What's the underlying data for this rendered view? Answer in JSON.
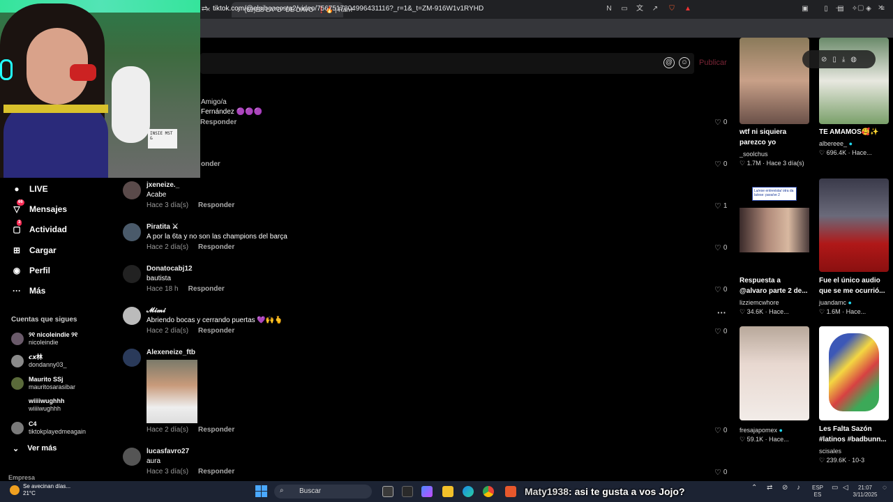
{
  "browser": {
    "tab_active": "(69)ES LA \"D\" DE DAVO",
    "tab_active_extra": "❗🔥 | Ran",
    "new_tab": "+",
    "close": "×",
    "url_site": "tiktok.com",
    "url_path": "/@elpibeacosta2/video/7567517804996431116?_r=1&_t=ZM-916W1v1RYHD",
    "win_min": "—",
    "win_max": "▢",
    "win_close": "✕"
  },
  "composer": {
    "at": "@",
    "emoji": "☺",
    "publish": "Publicar"
  },
  "webcam": {
    "sign_text": "INSIE\nMST\n&"
  },
  "sidebar": {
    "items": [
      {
        "label": "LIVE",
        "icon": "live-icon",
        "glyph": "●"
      },
      {
        "label": "Mensajes",
        "icon": "messages-icon",
        "glyph": "▽",
        "badge": "66"
      },
      {
        "label": "Actividad",
        "icon": "activity-icon",
        "glyph": "▢",
        "badge": "3"
      },
      {
        "label": "Cargar",
        "icon": "upload-icon",
        "glyph": "⊞"
      },
      {
        "label": "Perfil",
        "icon": "profile-icon",
        "glyph": "◉"
      },
      {
        "label": "Más",
        "icon": "more-icon",
        "glyph": "···"
      }
    ],
    "following_title": "Cuentas que sigues",
    "following": [
      {
        "name": "୨୧ nicoleindie ୨୧",
        "handle": "nicoleindie"
      },
      {
        "name": "𝙘𝙭林",
        "handle": "dondanny03_"
      },
      {
        "name": "Maurito SSj",
        "handle": "mauritosarasibar"
      },
      {
        "name": "wiiiiwughhh",
        "handle": "wiiiiwughhh"
      },
      {
        "name": "C4",
        "handle": "tiktokplayedmeagain"
      }
    ],
    "see_more": "Ver más",
    "see_more_icon": "⌄",
    "company": "Empresa"
  },
  "partial_comments": {
    "c1_user": "Amigo/a",
    "c1_text": "Fernández 🟣🟣🟣",
    "c1_reply": "Responder",
    "c2_reply": "onder"
  },
  "comments": [
    {
      "user": "jxeneize._",
      "text": "Acabe",
      "time": "Hace 3 día(s)",
      "reply": "Responder",
      "likes": "1"
    },
    {
      "user": "Piratita ⚔",
      "text": "A por la 6ta y no son las champions del barça",
      "time": "Hace 2 día(s)",
      "reply": "Responder",
      "likes": "0"
    },
    {
      "user": "Donatocabj12",
      "text": "bautista",
      "time": "Hace 18 h",
      "reply": "Responder",
      "likes": "0"
    },
    {
      "user": "𝓜𝓲𝓶𝓲",
      "text": "Abriendo bocas y cerrando puertas 💜🙌🫰",
      "time": "Hace 2 día(s)",
      "reply": "Responder",
      "likes": "0"
    },
    {
      "user": "Alexeneize_ftb",
      "text": "",
      "time": "Hace 2 día(s)",
      "reply": "Responder",
      "likes": "0"
    },
    {
      "user": "lucasfavro27",
      "text": "aura",
      "time": "Hace 3 día(s)",
      "reply": "Responder",
      "likes": "0"
    }
  ],
  "top_likes": [
    "0",
    "0"
  ],
  "heart": "♡",
  "more_dots": "···",
  "recommendations": [
    {
      "title1": "wtf ni siquiera",
      "title2": "parezco yo",
      "author": "_soolchus",
      "stats": "♡ 1.7M · Hace 3 día(s)"
    },
    {
      "title1": "TE AMAMOS🥰✨",
      "title2": "",
      "author": "albereee_",
      "stats": "♡ 696.4K · Hace..."
    },
    {
      "title1": "Respuesta a",
      "title2": "@alvaro parte 2 de...",
      "author": "lizziemcwhore",
      "stats": "♡ 34.6K · Hace..."
    },
    {
      "title1": "Fue el único audio",
      "title2": "que se me ocurrió...",
      "author": "juandamc",
      "stats": "♡ 1.6M · Hace..."
    },
    {
      "title1": "",
      "title2": "",
      "author": "fresajapomex",
      "stats": "♡ 59.1K · Hace..."
    },
    {
      "title1": "Les Falta Sazón",
      "title2": "#latinos #badbunn...",
      "author": "scisales",
      "stats": "♡ 239.6K · 10-3"
    }
  ],
  "rec_thumb_text": "La/ese entrevista/ otra da la/ese: para/ve 2",
  "verified": "●",
  "taskbar": {
    "weather_title": "Se avecinan días...",
    "weather_temp": "21°C",
    "search": "Buscar",
    "search_icon": "⌕",
    "chat_user": "Maty1938",
    "chat_text": ": asi te gusta a vos Jojo?",
    "lang1": "ESP",
    "lang2": "ES",
    "time": "21:07",
    "date": "3/11/2025"
  }
}
